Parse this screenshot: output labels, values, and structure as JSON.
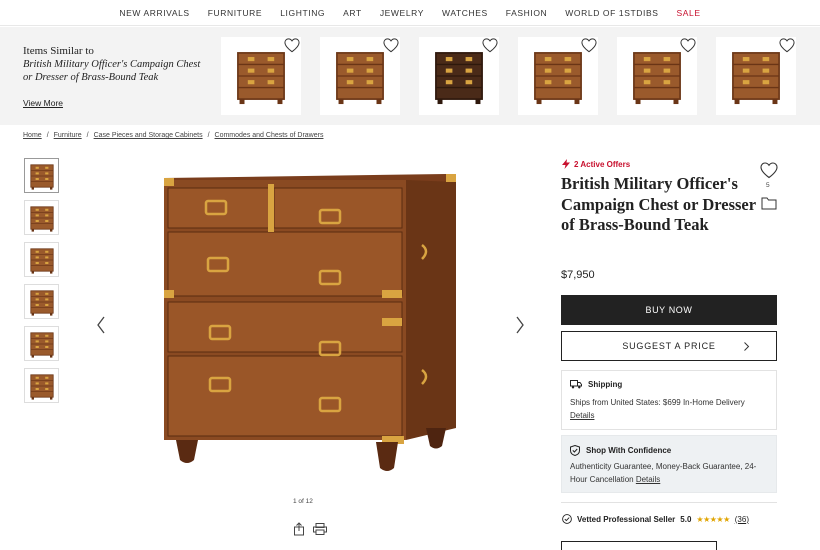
{
  "nav": {
    "items": [
      "NEW ARRIVALS",
      "FURNITURE",
      "LIGHTING",
      "ART",
      "JEWELRY",
      "WATCHES",
      "FASHION",
      "WORLD OF 1STDIBS"
    ],
    "sale": "SALE",
    "sale_color": "#c8102e"
  },
  "similar": {
    "heading": "Items Similar to",
    "item_name": "British Military Officer's Campaign Chest or Dresser of Brass-Bound Teak",
    "view_more": "View More",
    "thumbnail_count": 6
  },
  "breadcrumb": [
    "Home",
    "Furniture",
    "Case Pieces and Storage Cabinets",
    "Commodes and Chests of Drawers"
  ],
  "gallery": {
    "counter": "1 of 12",
    "thumbnail_count": 6,
    "icons": [
      "chevron-left-icon",
      "chevron-right-icon",
      "share-icon",
      "print-icon"
    ]
  },
  "product": {
    "offers": "2 Active Offers",
    "title": "British Military Officer's Campaign Chest or Dresser of Brass-Bound Teak",
    "favorite_count": "5",
    "price": "$7,950",
    "buy_now": "BUY NOW",
    "suggest_price": "SUGGEST A PRICE"
  },
  "shipping": {
    "heading": "Shipping",
    "text": "Ships from United States: $699 In-Home Delivery",
    "details": "Details"
  },
  "confidence": {
    "heading": "Shop With Confidence",
    "text": "Authenticity Guarantee, Money-Back Guarantee, 24-Hour Cancellation",
    "details": "Details"
  },
  "seller": {
    "label": "Vetted Professional Seller",
    "rating": "5.0",
    "stars": "★★★★★",
    "reviews": "(36)"
  },
  "colors": {
    "accent": "#c8102e",
    "button": "#222222",
    "star": "#e0a400",
    "wood": "#8a4a22"
  }
}
